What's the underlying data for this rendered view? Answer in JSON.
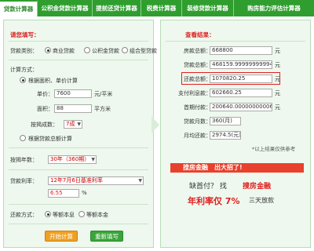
{
  "tabs": [
    "贷款计算器",
    "公积金贷款计算器",
    "提前还贷计算器",
    "税费计算器",
    "装修贷款计算器",
    "购房能力评估计算器"
  ],
  "left": {
    "title": "请您填写：",
    "loan_type": {
      "label": "贷款类别：",
      "options": [
        "商业贷款",
        "公积金贷款",
        "组合型贷款"
      ],
      "selected": 0
    },
    "calc_method": {
      "label": "计算方式：",
      "option1": "根据面积、单价计算",
      "unit_price": {
        "label": "单价：",
        "value": "7600",
        "unit": "元/平米"
      },
      "area": {
        "label": "面积：",
        "value": "88",
        "unit": "平方米"
      },
      "down_payment": {
        "label": "按揭成数：",
        "value": "7成"
      },
      "option2": "根据贷款总额计算"
    },
    "years": {
      "label": "按揭年数：",
      "value": "30年（360期）"
    },
    "rate": {
      "label": "贷款利率：",
      "value": "12年7月6日基准利率",
      "input": "6.55",
      "unit": "%"
    },
    "repay": {
      "label": "还款方式：",
      "options": [
        "等额本息",
        "等额本金"
      ],
      "selected": 0
    },
    "buttons": {
      "calc": "开始计算",
      "reset": "重新填写"
    }
  },
  "right": {
    "title": "查看结果：",
    "rows": [
      {
        "label": "房款总额：",
        "value": "668800",
        "unit": "元"
      },
      {
        "label": "贷款总额：",
        "value": "468159.99999999994",
        "unit": "元"
      },
      {
        "label": "还款总额：",
        "value": "1070820.25",
        "unit": "元"
      },
      {
        "label": "支付利息款：",
        "value": "602660.25",
        "unit": "元"
      },
      {
        "label": "首期付款：",
        "value": "200640.00000000006",
        "unit": "元"
      },
      {
        "label": "贷款月数：",
        "value": "360(月)",
        "unit": ""
      },
      {
        "label": "月均还款：",
        "value": "2974.5(元)",
        "unit": ""
      }
    ],
    "note": "*以上结果仅供参考",
    "ad": {
      "line1": "搜房金融　出大招了!",
      "line2_a": "缺首付？ 找",
      "line2_b": "搜房金融",
      "line3_a": "年利率仅 7%",
      "line3_b": "三天放款"
    }
  }
}
